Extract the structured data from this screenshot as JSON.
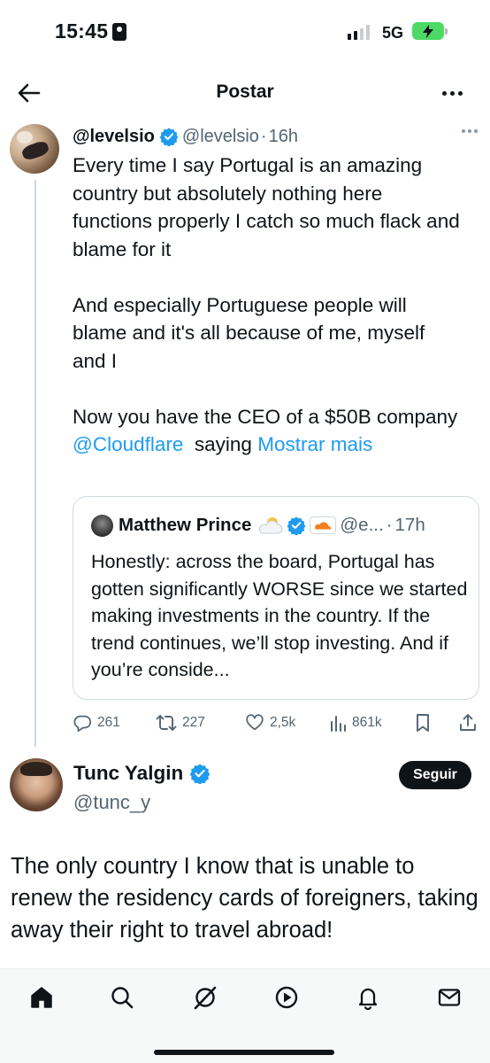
{
  "status_bar": {
    "time": "15:45",
    "network": "5G",
    "signal_bars": 4,
    "signal_bars_filled": 2,
    "battery_state": "charging"
  },
  "nav": {
    "title": "Postar",
    "back_icon": "arrow-left-icon",
    "more_icon": "more-horizontal-icon"
  },
  "tweet": {
    "display_name": "@levelsio",
    "handle": "@levelsio",
    "dot": "·",
    "time": "16h",
    "verified": true,
    "body_line1": "Every time I say Portugal is an amazing country but absolutely nothing here functions properly I catch so much flack and blame for it",
    "body_line2": "And especially Portuguese people will blame and it's all because of me, myself and I",
    "body_line3_pre": "Now you have the CEO of a $50B company ",
    "mention": "@Cloudflare",
    "body_line3_post": "  saying ",
    "show_more": "Mostrar mais"
  },
  "quote": {
    "display_name": "Matthew Prince",
    "emoji_icon": "sun-behind-cloud-icon",
    "affiliate_icon": "cloudflare-logo-icon",
    "handle": "@e...",
    "dot": "·",
    "time": "17h",
    "body": "Honestly: across the board, Portugal has gotten significantly WORSE since we started making investments in the country. If the trend continues, we’ll stop investing. And if you’re conside..."
  },
  "actions": {
    "replies": "261",
    "reposts": "227",
    "likes": "2,5k",
    "views": "861k",
    "icons": [
      "reply-icon",
      "repost-icon",
      "like-icon",
      "views-icon",
      "bookmark-icon",
      "share-icon"
    ]
  },
  "reply_tweet": {
    "display_name": "Tunc Yalgin",
    "handle": "@tunc_y",
    "verified": true,
    "follow_label": "Seguir",
    "body": "The only country I know that is unable to renew the residency cards of foreigners, taking away their right to travel abroad!"
  },
  "tab_bar": {
    "items": [
      "home-icon",
      "search-icon",
      "grok-icon",
      "video-icon",
      "notifications-icon",
      "messages-icon"
    ],
    "active": "home-icon"
  },
  "colors": {
    "text": "#0f1419",
    "secondary": "#536471",
    "link": "#1d9bf0",
    "verified": "#1d9bf0",
    "border": "#cfd9de",
    "battery": "#4cd964"
  }
}
